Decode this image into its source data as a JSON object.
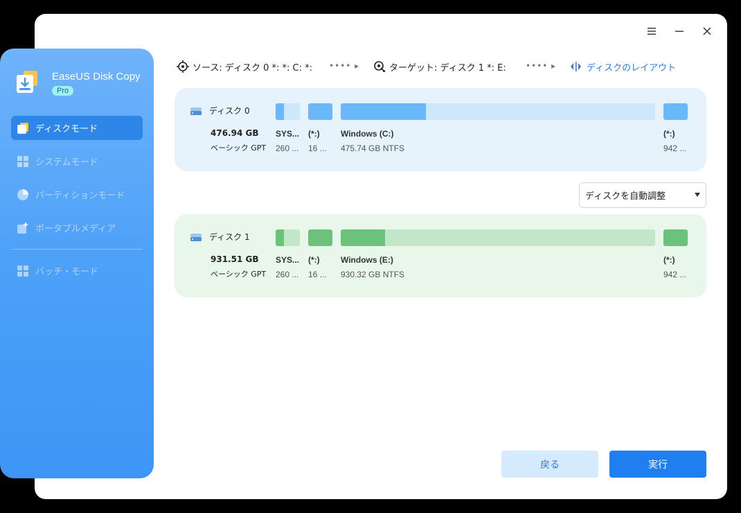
{
  "app": {
    "title": "EaseUS Disk Copy",
    "badge": "Pro"
  },
  "sidebar": {
    "items": [
      {
        "label": "ディスクモード",
        "icon": "disk-mode-icon",
        "state": "active"
      },
      {
        "label": "システムモード",
        "icon": "windows-icon",
        "state": "disabled"
      },
      {
        "label": "パーティションモード",
        "icon": "pie-icon",
        "state": "disabled"
      },
      {
        "label": "ポータブルメディア",
        "icon": "portable-media-icon",
        "state": "disabled"
      },
      {
        "label": "バッチ・モード",
        "icon": "batch-icon",
        "state": "disabled"
      }
    ]
  },
  "topbar": {
    "source": "ソース: ディスク 0 *: *: C: *:",
    "target": "ターゲット: ディスク 1 *: E:",
    "layout_link": "ディスクのレイアウト"
  },
  "source_disk": {
    "name": "ディスク 0",
    "size": "476.94 GB",
    "type": "ベーシック GPT",
    "partitions": [
      {
        "label": "SYS...",
        "sub": "260 ...",
        "fill": 0.35
      },
      {
        "label": "(*:)",
        "sub": "16 ...",
        "fill": 1.0
      },
      {
        "label": "Windows (C:)",
        "sub": "475.74 GB NTFS",
        "fill": 0.27
      },
      {
        "label": "(*:)",
        "sub": "942 ...",
        "fill": 1.0
      }
    ]
  },
  "target_disk": {
    "name": "ディスク 1",
    "size": "931.51 GB",
    "type": "ベーシック GPT",
    "partitions": [
      {
        "label": "SYS...",
        "sub": "260 ...",
        "fill": 0.35
      },
      {
        "label": "(*:)",
        "sub": "16 ...",
        "fill": 1.0
      },
      {
        "label": "Windows (E:)",
        "sub": "930.32 GB NTFS",
        "fill": 0.14
      },
      {
        "label": "(*:)",
        "sub": "942 ...",
        "fill": 1.0
      }
    ]
  },
  "dropdown": {
    "value": "ディスクを自動調整"
  },
  "buttons": {
    "back": "戻る",
    "execute": "実行"
  },
  "colors": {
    "accent": "#1f7ff0",
    "source_fill": "#6ab7f9",
    "source_track": "#cfe7fb",
    "target_fill": "#6cc27b",
    "target_track": "#c4e6c8"
  }
}
